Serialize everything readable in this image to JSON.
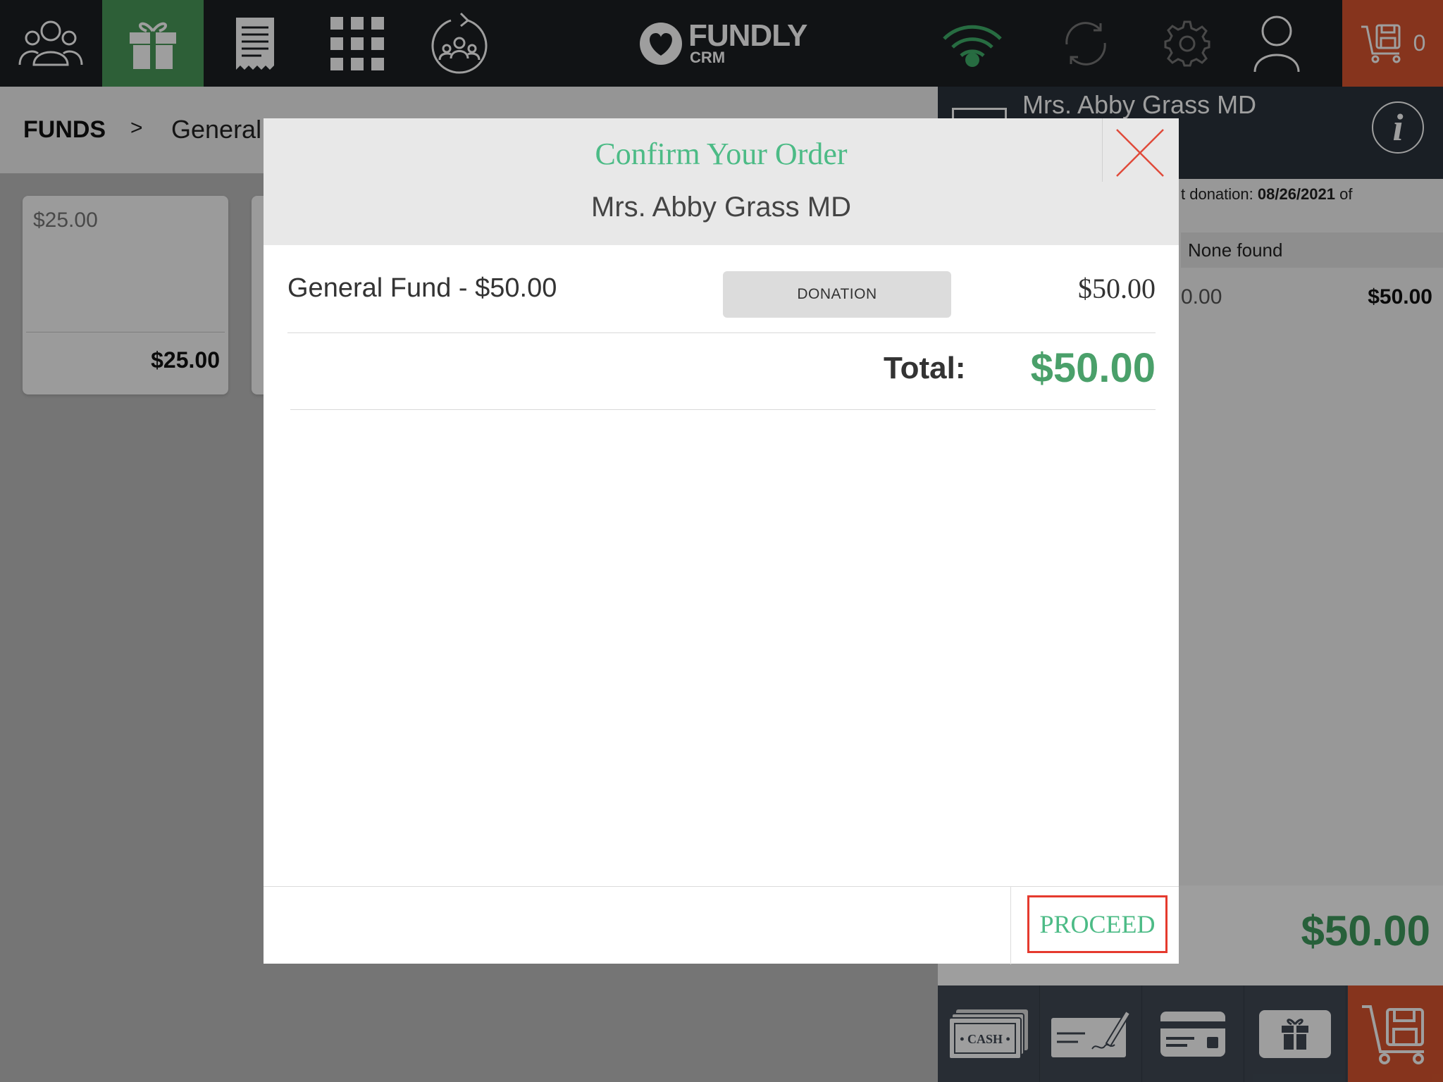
{
  "topbar": {
    "logo_text": "FUNDLY",
    "logo_sub": "CRM",
    "cart_count": "0"
  },
  "breadcrumb": {
    "root": "FUNDS",
    "separator": ">",
    "current": "General F"
  },
  "cards": [
    {
      "amount_label": "$25.00",
      "price": "$25.00"
    }
  ],
  "customer_panel": {
    "name": "Mrs. Abby Grass MD",
    "info_glyph": "i",
    "last_donation_prefix": "t donation: ",
    "last_donation_date": "08/26/2021",
    "last_donation_suffix": " of",
    "none_found": "None found",
    "line_item_left": "0.00",
    "line_item_right": "$50.00",
    "total": "$50.00",
    "payment_methods": [
      "cash",
      "check",
      "credit-card",
      "gift"
    ]
  },
  "modal": {
    "title": "Confirm Your Order",
    "customer": "Mrs. Abby Grass MD",
    "items": [
      {
        "name": "General Fund - $50.00",
        "type": "DONATION",
        "price": "$50.00"
      }
    ],
    "total_label": "Total:",
    "total_value": "$50.00",
    "proceed_label": "PROCEED"
  },
  "colors": {
    "topbar": "#1c1f22",
    "active_nav": "#4a9a5a",
    "cart": "#d9552f",
    "accent_green": "#4cbb86",
    "total_green": "#4aa06a",
    "highlight_red": "#e53a2e"
  }
}
